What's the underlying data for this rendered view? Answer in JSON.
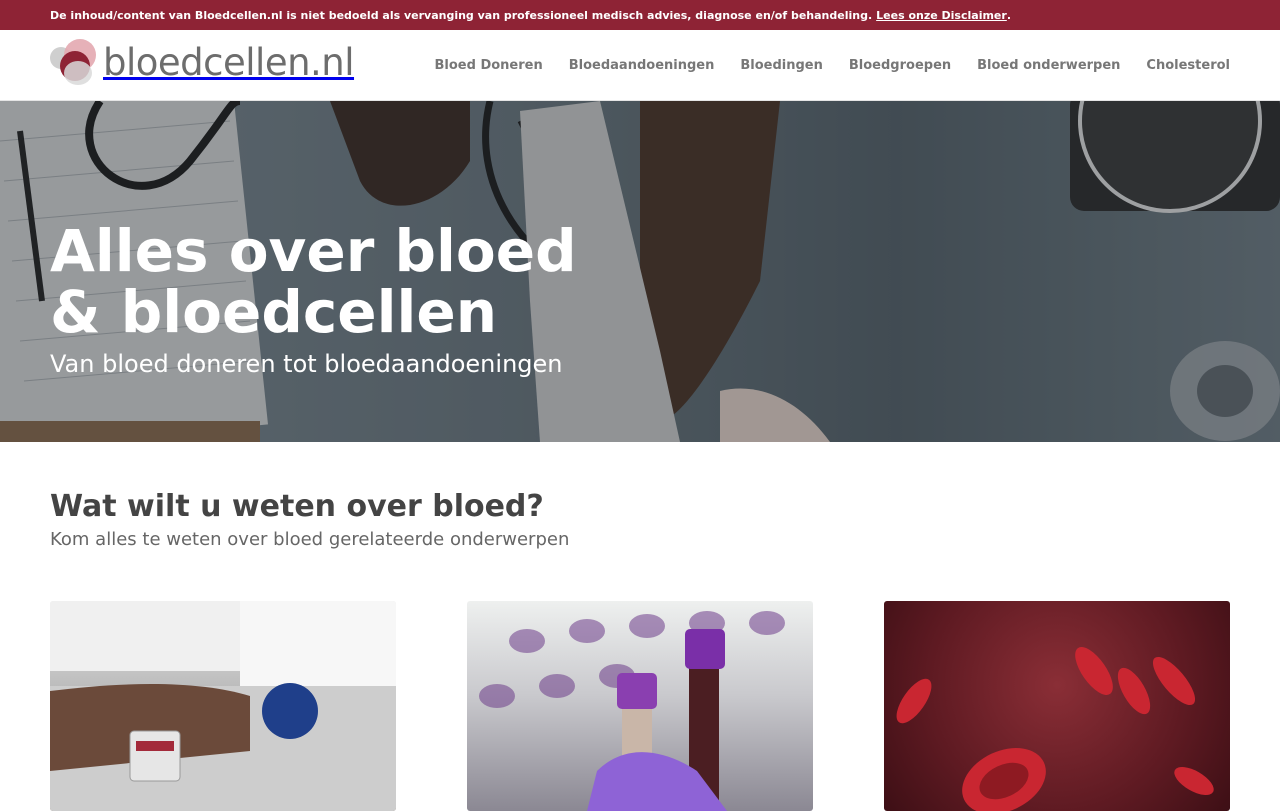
{
  "disclaimer": {
    "text": "De inhoud/content van Bloedcellen.nl is niet bedoeld als vervanging van professioneel medisch advies, diagnose en/of behandeling.",
    "link_label": "Lees onze Disclaimer",
    "suffix": "."
  },
  "logo": {
    "text": "bloedcellen.nl"
  },
  "nav": {
    "items": [
      {
        "label": "Bloed Doneren"
      },
      {
        "label": "Bloedaandoeningen"
      },
      {
        "label": "Bloedingen"
      },
      {
        "label": "Bloedgroepen"
      },
      {
        "label": "Bloed onderwerpen"
      },
      {
        "label": "Cholesterol"
      }
    ]
  },
  "hero": {
    "title_line1": "Alles over bloed",
    "title_line2": "& bloedcellen",
    "subtitle": "Van bloed doneren tot bloedaandoeningen"
  },
  "intro": {
    "title": "Wat wilt u weten over bloed?",
    "subtitle": "Kom alles te weten over bloed gerelateerde onderwerpen"
  },
  "colors": {
    "accent": "#8e2335",
    "nav_text": "#777777",
    "heading_text": "#444444"
  }
}
